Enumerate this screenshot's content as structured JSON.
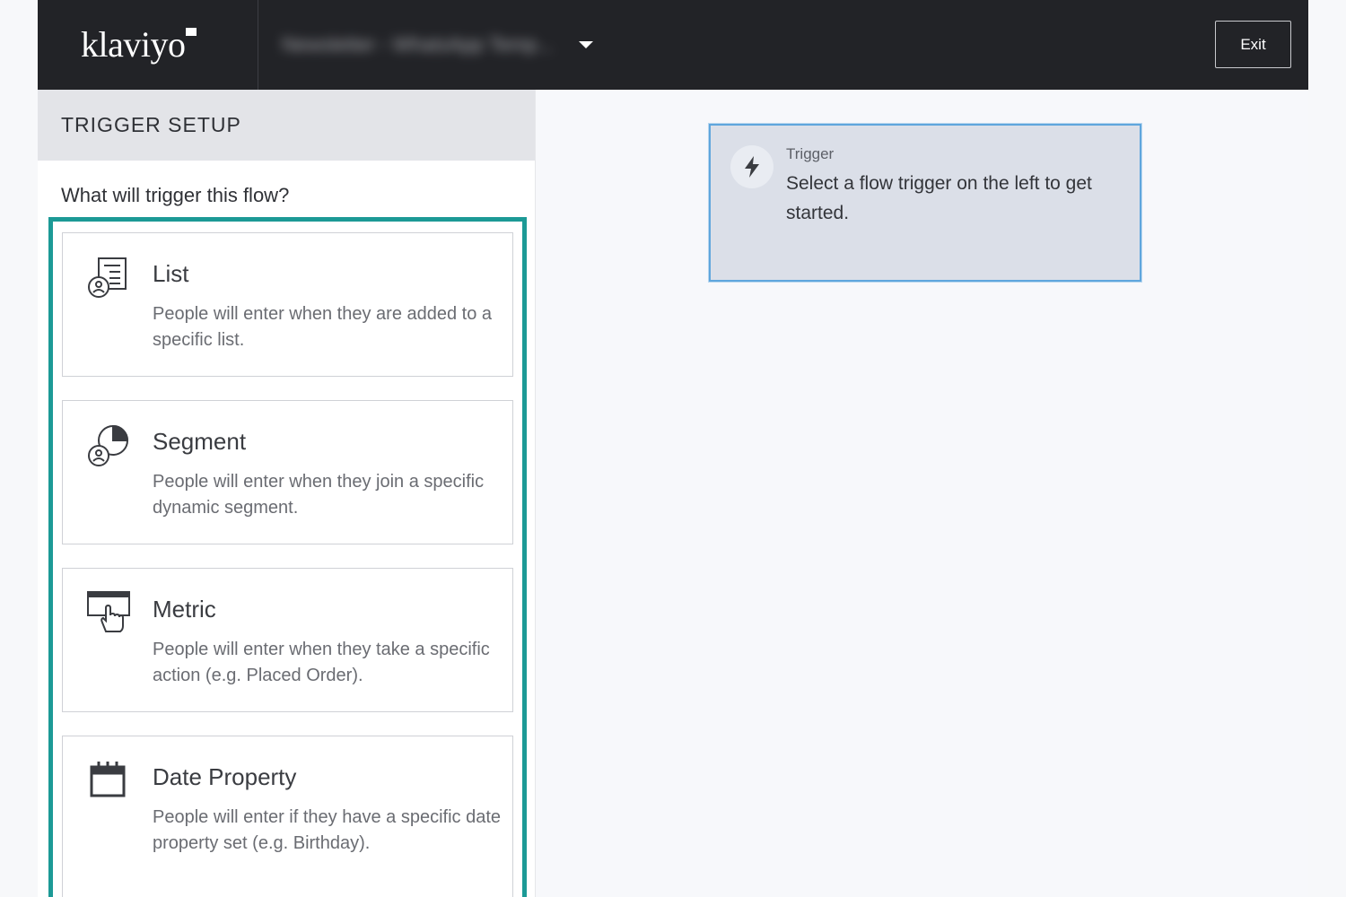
{
  "header": {
    "logo": "klaviyo",
    "flow_name": "Newsletter - WhatsApp Temp...",
    "exit_label": "Exit"
  },
  "sidebar": {
    "title": "TRIGGER SETUP",
    "question": "What will trigger this flow?",
    "options": [
      {
        "title": "List",
        "description": "People will enter when they are added to a specific list.",
        "icon": "list-icon"
      },
      {
        "title": "Segment",
        "description": "People will enter when they join a specific dynamic segment.",
        "icon": "segment-icon"
      },
      {
        "title": "Metric",
        "description": "People will enter when they take a specific action (e.g. Placed Order).",
        "icon": "metric-icon"
      },
      {
        "title": "Date Property",
        "description": "People will enter if they have a specific date property set (e.g. Birthday).",
        "icon": "calendar-icon"
      }
    ]
  },
  "canvas": {
    "trigger_node": {
      "label": "Trigger",
      "text": "Select a flow trigger on the left to get started.",
      "icon": "lightning-bolt-icon"
    }
  },
  "colors": {
    "topbar": "#222327",
    "accent_teal": "#1c9a96",
    "node_border": "#5fa6dd",
    "node_bg": "#dbdfe8"
  }
}
